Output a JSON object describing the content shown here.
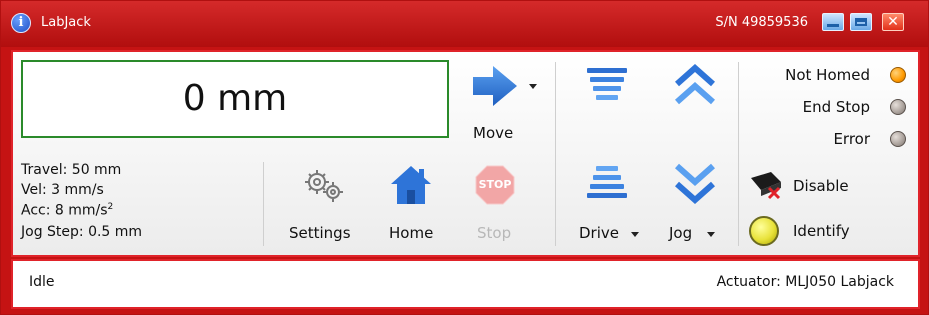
{
  "window": {
    "title": "LabJack",
    "serial": "S/N 49859536",
    "close_glyph": "✕",
    "info_glyph": "i",
    "icons": [
      "info-icon",
      "minimize-icon",
      "maximize-icon",
      "close-icon"
    ]
  },
  "display": {
    "position": "0 mm"
  },
  "params": {
    "travel": "Travel: 50 mm",
    "vel": "Vel: 3 mm/s",
    "acc": "Acc: 8 mm/s",
    "acc_sup": "2",
    "jog_step": "Jog Step: 0.5 mm"
  },
  "buttons": {
    "move": "Move",
    "settings": "Settings",
    "home": "Home",
    "stop": "Stop",
    "stop_sign": "STOP",
    "drive": "Drive",
    "jog": "Jog",
    "disable": "Disable",
    "identify": "Identify"
  },
  "indicators": [
    {
      "label": "Not Homed",
      "color": "#ff9a00"
    },
    {
      "label": "End Stop",
      "color": "#a9a09a"
    },
    {
      "label": "Error",
      "color": "#a9a09a"
    }
  ],
  "status": {
    "text": "Idle",
    "actuator": "Actuator:   MLJ050 Labjack"
  },
  "colors": {
    "titlebar": "#c51313",
    "panel_border": "#e0232a",
    "display_border": "#2a8a2a",
    "accent_blue": "#2e74d8",
    "disabled_text": "#b8b8b8"
  }
}
